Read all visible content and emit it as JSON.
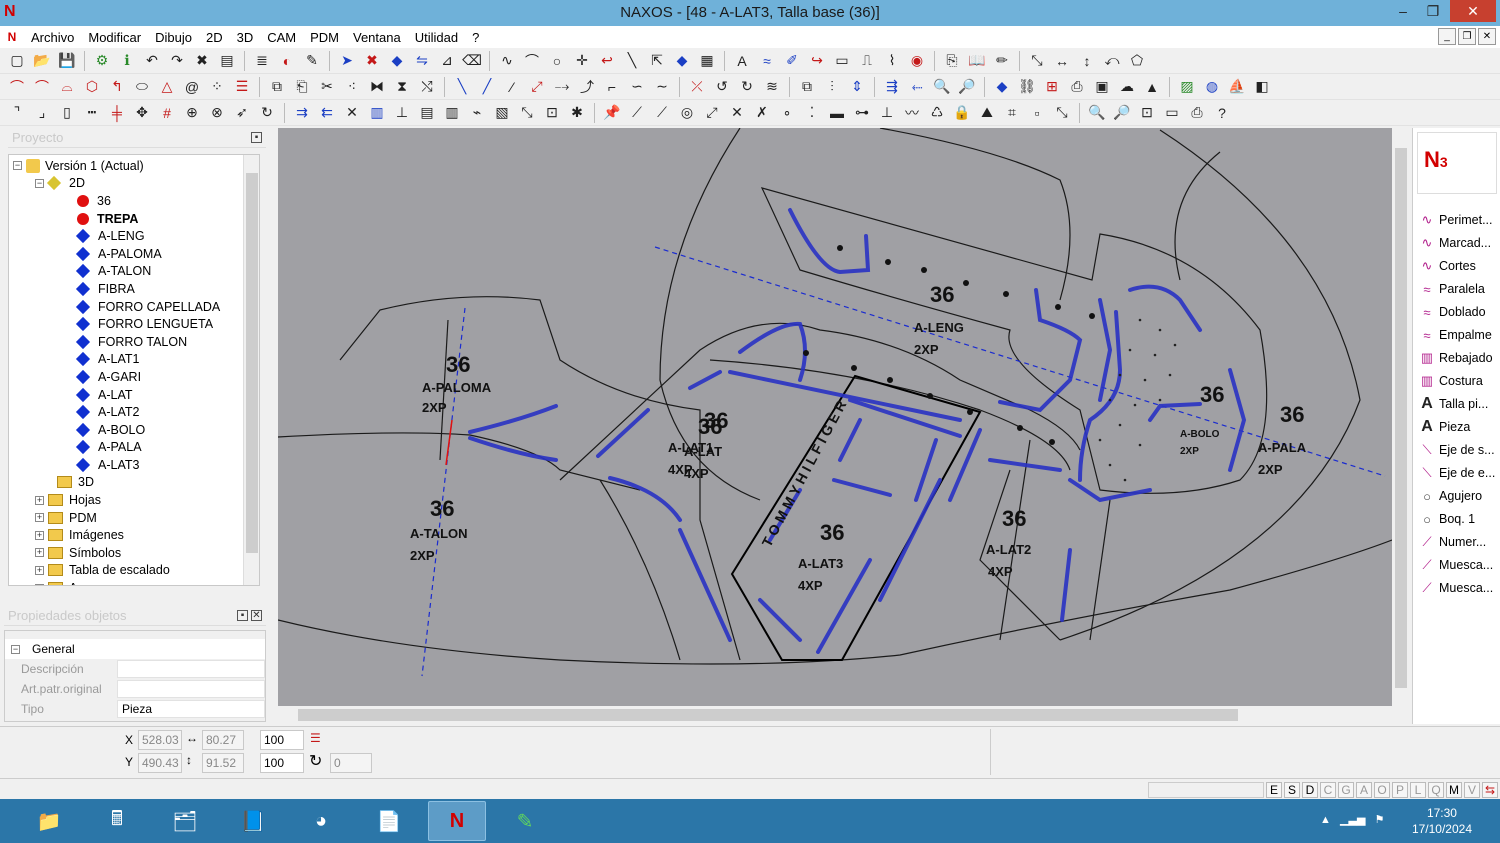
{
  "window": {
    "title": "NAXOS - [48 - A-LAT3, Talla base (36)]",
    "logo": "N",
    "minimize": "–",
    "restore": "❐",
    "close": "✕"
  },
  "menu": {
    "items": [
      "Archivo",
      "Modificar",
      "Dibujo",
      "2D",
      "3D",
      "CAM",
      "PDM",
      "Ventana",
      "Utilidad",
      "?"
    ]
  },
  "project_panel": {
    "title": "Proyecto"
  },
  "tree": {
    "root": "Versión 1 (Actual)",
    "group_2d": "2D",
    "items": [
      "36",
      "TREPA",
      "A-LENG",
      "A-PALOMA",
      "A-TALON",
      "FIBRA",
      "FORRO CAPELLADA",
      "FORRO LENGUETA",
      "FORRO TALON",
      "A-LAT1",
      "A-GARI",
      "A-LAT",
      "A-LAT2",
      "A-BOLO",
      "A-PALA",
      "A-LAT3"
    ],
    "bottom": [
      "3D",
      "Hojas",
      "PDM",
      "Imágenes",
      "Símbolos",
      "Tabla de escalado",
      "Anexos"
    ]
  },
  "props_panel": {
    "title": "Propiedades objetos",
    "section": "General",
    "rows": [
      {
        "key": "Descripción",
        "value": ""
      },
      {
        "key": "Art.patr.original",
        "value": ""
      },
      {
        "key": "Tipo",
        "value": "Pieza"
      }
    ]
  },
  "canvas_labels": {
    "size": "36",
    "pieces": [
      {
        "name": "A-PALOMA",
        "qty": "2XP"
      },
      {
        "name": "A-TALON",
        "qty": "2XP"
      },
      {
        "name": "A-LENG",
        "qty": "2XP"
      },
      {
        "name": "A-LAT1",
        "qty": "4XP"
      },
      {
        "name": "A-LAT",
        "qty": "4XP"
      },
      {
        "name": "A-LAT3",
        "qty": "4XP"
      },
      {
        "name": "A-LAT2",
        "qty": "4XP"
      },
      {
        "name": "A-BOLO",
        "qty": "2XP"
      },
      {
        "name": "A-PALA",
        "qty": "2XP"
      }
    ],
    "brand": "T O M M Y   H I L F I G E R"
  },
  "right_tools": [
    "Perimet...",
    "Marcad...",
    "Cortes",
    "Paralela",
    "Doblado",
    "Empalme",
    "Rebajado",
    "Costura",
    "Talla pi...",
    "Pieza",
    "Eje de s...",
    "Eje de e...",
    "Agujero",
    "Boq. 1",
    "Numer...",
    "Muesca...",
    "Muesca..."
  ],
  "coords": {
    "x_label": "X",
    "y_label": "Y",
    "x": "528.03",
    "y": "490.43",
    "w": "80.27",
    "h": "91.52",
    "sx": "100",
    "sy": "100",
    "angle": "0"
  },
  "status_flags": [
    "E",
    "S",
    "D",
    "C",
    "G",
    "A",
    "O",
    "P",
    "L",
    "Q",
    "M",
    "V"
  ],
  "taskbar": {
    "time": "17:30",
    "date": "17/10/2024"
  }
}
